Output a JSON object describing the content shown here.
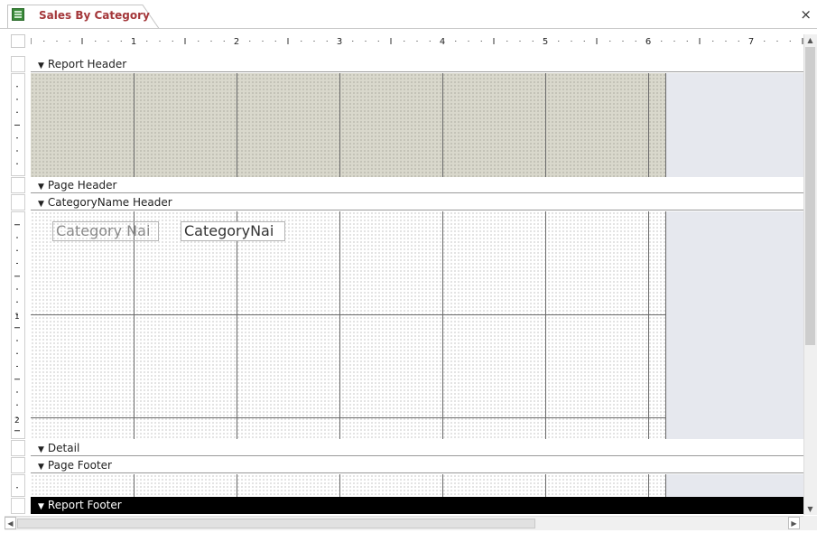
{
  "tab": {
    "title": "Sales By Category",
    "close_symbol": "×"
  },
  "ruler": {
    "numbers": [
      "1",
      "2",
      "3",
      "4",
      "5",
      "6",
      "7"
    ],
    "vertical_numbers": [
      "1",
      "2"
    ]
  },
  "sections": {
    "report_header": "Report Header",
    "page_header": "Page Header",
    "categoryname_header": "CategoryName Header",
    "detail": "Detail",
    "page_footer": "Page Footer",
    "report_footer": "Report Footer"
  },
  "controls": {
    "category_label": "Category Nai",
    "category_textbox": "CategoryNai"
  },
  "icons": {
    "tab_icon": "report-icon",
    "band_arrow": "down-arrow-icon",
    "scroll_up": "scroll-up-icon",
    "scroll_down": "scroll-down-icon",
    "scroll_left": "scroll-left-icon",
    "scroll_right": "scroll-right-icon"
  },
  "colors": {
    "tab_title": "#a4373a",
    "report_header_fill": "#d9d8cc",
    "selected_band": "#000000",
    "empty_area": "#e6e8ee"
  }
}
